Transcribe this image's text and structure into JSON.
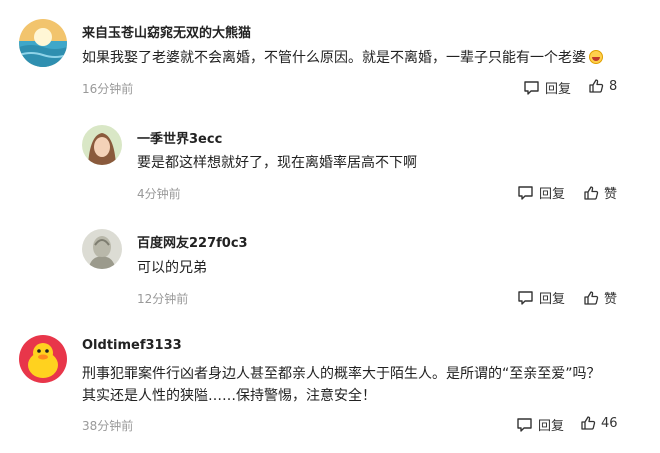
{
  "comments": [
    {
      "username": "来自玉苍山窈窕无双的大熊猫",
      "text": "如果我娶了老婆就不会离婚，不管什么原因。就是不离婚，一辈子只能有一个老婆",
      "emoji": "grinning-emoji",
      "time": "16分钟前",
      "reply_label": "回复",
      "like_label": "8",
      "replies": [
        {
          "username": "一季世界3ecc",
          "text": "要是都这样想就好了，现在离婚率居高不下啊",
          "time": "4分钟前",
          "reply_label": "回复",
          "like_label": "赞"
        },
        {
          "username": "百度网友227f0c3",
          "text": "可以的兄弟",
          "time": "12分钟前",
          "reply_label": "回复",
          "like_label": "赞"
        }
      ]
    },
    {
      "username": "Oldtimef3133",
      "text_line1": "刑事犯罪案件行凶者身边人甚至都亲人的概率大于陌生人。是所谓的“至亲至爱”吗？",
      "text_line2": "其实还是人性的狭隘……保持警惕，注意安全！",
      "time": "38分钟前",
      "reply_label": "回复",
      "like_label": "46"
    }
  ],
  "colors": {
    "name": "#222222",
    "text": "#222222",
    "time": "#999999",
    "action": "#333333"
  }
}
